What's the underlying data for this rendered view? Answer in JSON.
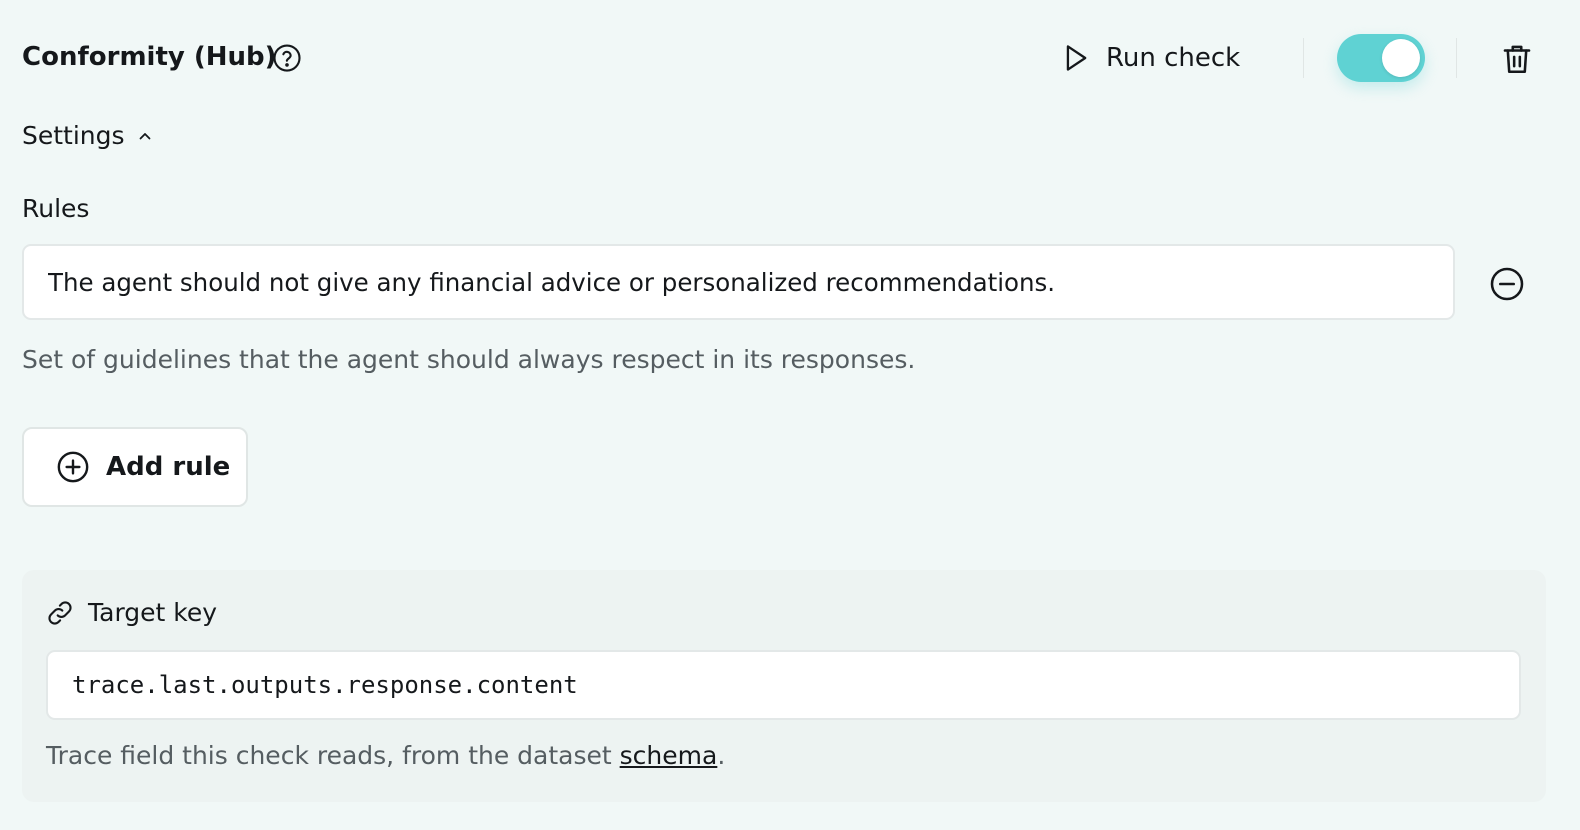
{
  "header": {
    "title": "Conformity (Hub)",
    "help_icon": "question-circle-icon",
    "run_check_label": "Run check",
    "run_icon": "play-icon",
    "enabled_toggle": {
      "on": true,
      "color": "#5fd2d3"
    },
    "delete_icon": "trash-icon"
  },
  "settings": {
    "label": "Settings",
    "icon": "chevron-up-icon"
  },
  "rules": {
    "label": "Rules",
    "items": [
      {
        "value": "The agent should not give any financial advice or personalized recommendations.",
        "remove_icon": "minus-circle-icon"
      }
    ],
    "help_text": "Set of guidelines that the agent should always respect in its responses.",
    "add_label": "Add rule",
    "add_icon": "plus-circle-icon"
  },
  "target_key": {
    "label": "Target key",
    "icon": "link-icon",
    "value": "trace.last.outputs.response.content",
    "help_prefix": "Trace field this check reads, from the dataset ",
    "help_link": "schema",
    "help_suffix": "."
  },
  "colors": {
    "background": "#f1f8f7",
    "accent": "#5fd2d3",
    "panel": "#edf3f2",
    "text": "#15181b",
    "muted": "#555d61"
  }
}
